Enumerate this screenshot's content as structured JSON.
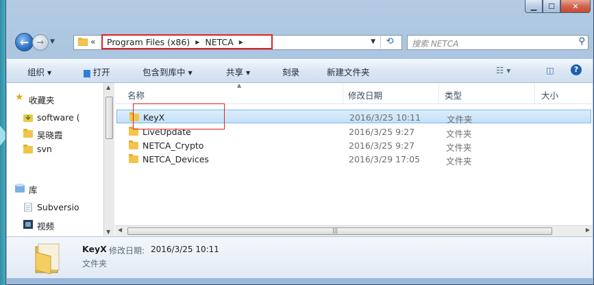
{
  "colors": {
    "accent_blue": "#2b6fc2",
    "selection": "#c4e0f8",
    "highlight_red": "#e02020",
    "folder_yellow": "#f2c54a"
  },
  "window": {
    "caption_buttons": [
      "minimize-icon",
      "maximize-icon",
      "close-icon"
    ]
  },
  "nav": {
    "overflow_glyph": "«",
    "breadcrumbs": [
      "Program Files (x86)",
      "NETCA"
    ],
    "search_placeholder": "搜索 NETCA"
  },
  "toolbar": {
    "organize": "组织",
    "open": "打开",
    "include_library": "包含到库中",
    "share": "共享",
    "burn": "刻录",
    "new_folder": "新建文件夹"
  },
  "sidebar": {
    "favorites": "收藏夹",
    "items": [
      "software (",
      "吴晓霞",
      "svn"
    ],
    "library": "库",
    "library_items": [
      "Subversio",
      "视频"
    ]
  },
  "columns": {
    "name": "名称",
    "date": "修改日期",
    "type": "类型",
    "size": "大小"
  },
  "files": [
    {
      "name": "KeyX",
      "date": "2016/3/25 10:11",
      "type": "文件夹",
      "selected": true
    },
    {
      "name": "LiveUpdate",
      "date": "2016/3/25 9:27",
      "type": "文件夹",
      "selected": false
    },
    {
      "name": "NETCA_Crypto",
      "date": "2016/3/25 9:27",
      "type": "文件夹",
      "selected": false
    },
    {
      "name": "NETCA_Devices",
      "date": "2016/3/29 17:05",
      "type": "文件夹",
      "selected": false
    }
  ],
  "details": {
    "name": "KeyX",
    "modified_label": "修改日期:",
    "modified_value": "2016/3/25 10:11",
    "type": "文件夹"
  }
}
